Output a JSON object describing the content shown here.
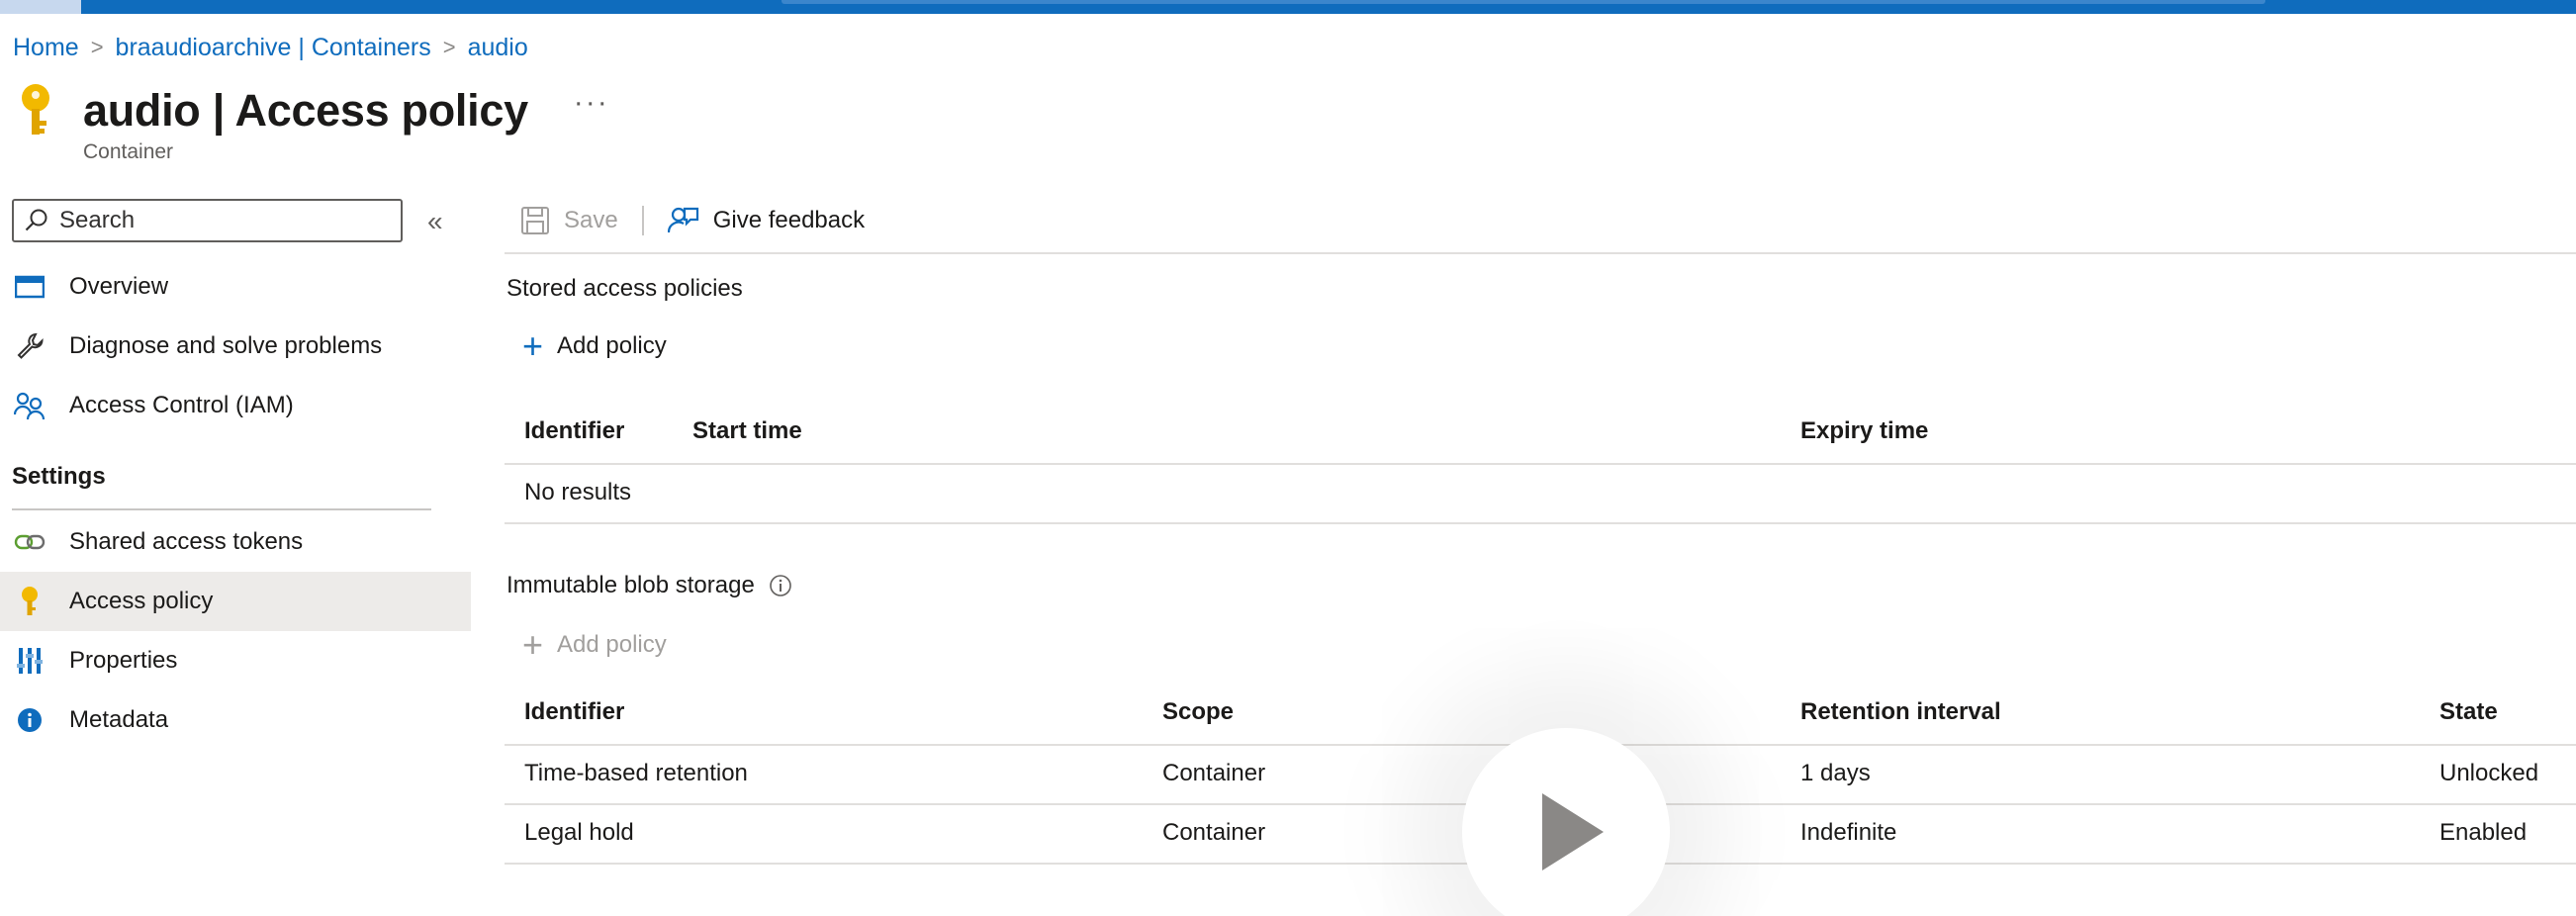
{
  "breadcrumb": {
    "items": [
      "Home",
      "braaudioarchive | Containers",
      "audio"
    ],
    "separator": ">"
  },
  "header": {
    "title_bold": "audio",
    "title_rest": " | Access policy",
    "subtitle": "Container",
    "more": "···",
    "icon": "key-icon"
  },
  "sidebar": {
    "search_placeholder": "Search",
    "collapse": "«",
    "items": [
      {
        "label": "Overview",
        "icon": "overview-icon"
      },
      {
        "label": "Diagnose and solve problems",
        "icon": "wrench-icon"
      },
      {
        "label": "Access Control (IAM)",
        "icon": "people-icon"
      }
    ],
    "section": "Settings",
    "settings_items": [
      {
        "label": "Shared access tokens",
        "icon": "link-icon"
      },
      {
        "label": "Access policy",
        "icon": "key-icon",
        "active": true
      },
      {
        "label": "Properties",
        "icon": "properties-icon"
      },
      {
        "label": "Metadata",
        "icon": "info-icon"
      }
    ]
  },
  "toolbar": {
    "save_label": "Save",
    "feedback_label": "Give feedback"
  },
  "stored": {
    "title": "Stored access policies",
    "add_label": "Add policy",
    "columns": [
      "Identifier",
      "Start time",
      "Expiry time"
    ],
    "empty": "No results"
  },
  "immutable": {
    "title": "Immutable blob storage",
    "add_label": "Add policy",
    "columns": [
      "Identifier",
      "Scope",
      "Retention interval",
      "State"
    ],
    "rows": [
      [
        "Time-based retention",
        "Container",
        "1 days",
        "Unlocked"
      ],
      [
        "Legal hold",
        "Container",
        "Indefinite",
        "Enabled"
      ]
    ]
  },
  "colors": {
    "accent": "#0f6cbd",
    "key": "#f2b900",
    "active_bg": "#edebe9"
  }
}
